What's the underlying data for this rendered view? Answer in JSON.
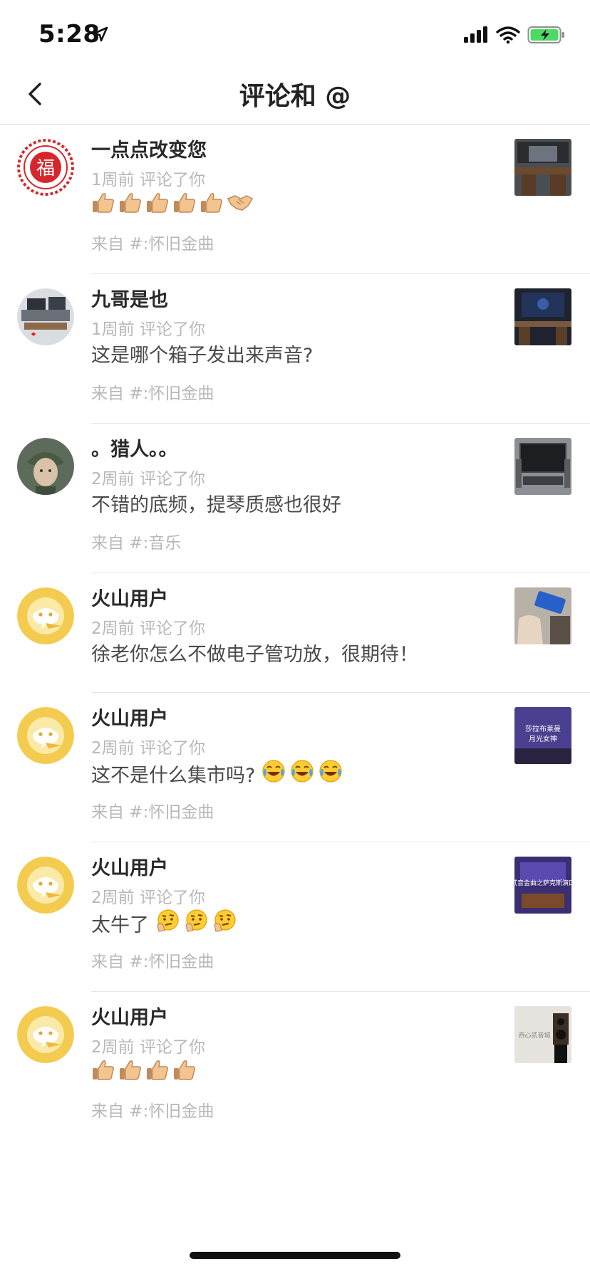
{
  "status_bar": {
    "time": "5:28"
  },
  "nav": {
    "title": "评论和 @"
  },
  "comments": [
    {
      "name": "一点点改变您",
      "meta": "1周前 评论了你",
      "text": "",
      "emojis": [
        "thumbs-up",
        "thumbs-up",
        "thumbs-up",
        "thumbs-up",
        "thumbs-up",
        "handshake"
      ],
      "source": "来自 #:怀旧金曲",
      "avatar": "fu-paper-cut",
      "thumb": "studio-desk"
    },
    {
      "name": "九哥是也",
      "meta": "1周前 评论了你",
      "text": "这是哪个箱子发出来声音?",
      "emojis": [],
      "source": "来自 #:怀旧金曲",
      "avatar": "studio-photo",
      "thumb": "dark-room"
    },
    {
      "name": "。猎人。。",
      "meta": "2周前 评论了你",
      "text": "不错的底频，提琴质感也很好",
      "emojis": [],
      "source": "来自 #:音乐",
      "avatar": "soldier-photo",
      "thumb": "tv-setup"
    },
    {
      "name": "火山用户",
      "meta": "2周前 评论了你",
      "text": "徐老你怎么不做电子管功放，很期待！",
      "emojis": [],
      "source": "",
      "avatar": "default-volcano",
      "thumb": "hand-device"
    },
    {
      "name": "火山用户",
      "meta": "2周前 评论了你",
      "text": "这不是什么集市吗?",
      "emojis": [
        "laugh-cry",
        "laugh-cry",
        "laugh-cry"
      ],
      "source": "来自 #:怀旧金曲",
      "avatar": "default-volcano",
      "thumb": "purple-screen"
    },
    {
      "name": "火山用户",
      "meta": "2周前 评论了你",
      "text": "太牛了",
      "emojis": [
        "thinking",
        "thinking",
        "thinking"
      ],
      "source": "来自 #:怀旧金曲",
      "avatar": "default-volcano",
      "thumb": "purple-banner"
    },
    {
      "name": "火山用户",
      "meta": "2周前 评论了你",
      "text": "",
      "emojis": [
        "thumbs-up",
        "thumbs-up",
        "thumbs-up",
        "thumbs-up"
      ],
      "source": "来自 #:怀旧金曲",
      "avatar": "default-volcano",
      "thumb": "speaker-room"
    }
  ],
  "thumb_texts": {
    "purple-screen": [
      "莎拉布莱曼",
      "月光女神"
    ],
    "purple-banner": [
      "贰音金曲之萨克斯演口"
    ],
    "speaker-room": [
      "西心贰音城"
    ]
  }
}
